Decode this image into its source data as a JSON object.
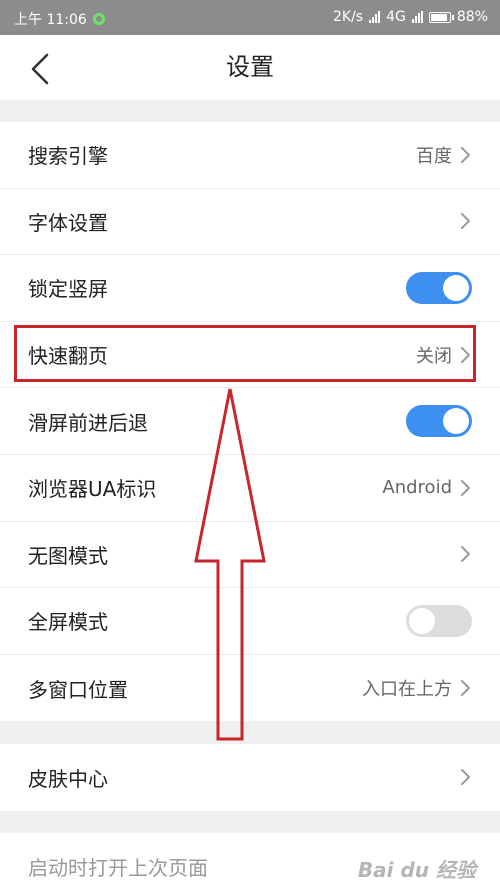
{
  "status_bar": {
    "time": "上午 11:06",
    "net_speed": "2K/s",
    "network": "4G",
    "battery": "88%"
  },
  "nav": {
    "title": "设置"
  },
  "settings_group_1": [
    {
      "label": "搜索引擎",
      "value": "百度",
      "type": "link"
    },
    {
      "label": "字体设置",
      "value": "",
      "type": "link"
    },
    {
      "label": "锁定竖屏",
      "type": "toggle",
      "on": true
    },
    {
      "label": "快速翻页",
      "value": "关闭",
      "type": "link"
    },
    {
      "label": "滑屏前进后退",
      "type": "toggle",
      "on": true
    },
    {
      "label": "浏览器UA标识",
      "value": "Android",
      "type": "link"
    },
    {
      "label": "无图模式",
      "value": "",
      "type": "link"
    },
    {
      "label": "全屏模式",
      "type": "toggle",
      "on": false
    },
    {
      "label": "多窗口位置",
      "value": "入口在上方",
      "type": "link"
    }
  ],
  "settings_group_2": [
    {
      "label": "皮肤中心",
      "value": "",
      "type": "link"
    }
  ],
  "settings_group_3": [
    {
      "label": "启动时打开上次页面"
    }
  ],
  "watermark": {
    "text": "Bai du 经验"
  },
  "colors": {
    "accent": "#3d8ff0",
    "annotation": "#c8252d",
    "status_bar": "#8c8c8c"
  }
}
